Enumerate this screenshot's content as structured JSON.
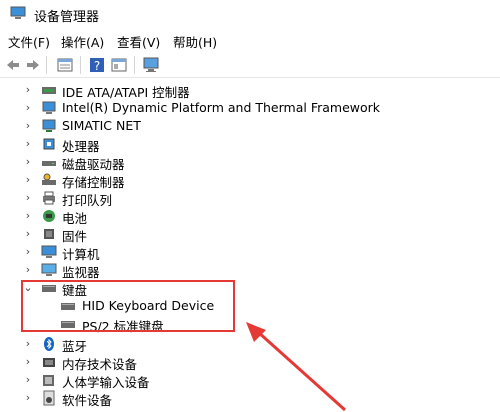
{
  "window": {
    "title": "设备管理器"
  },
  "menu": [
    {
      "label": "文件(F)"
    },
    {
      "label": "操作(A)"
    },
    {
      "label": "查看(V)"
    },
    {
      "label": "帮助(H)"
    }
  ],
  "toolbar": {
    "buttons": [
      "back-icon",
      "forward-icon",
      "properties-icon",
      "help-icon",
      "details-icon",
      "computer-icon"
    ]
  },
  "tree": [
    {
      "label": "IDE ATA/ATAPI 控制器",
      "icon": "ide-controller-icon",
      "expanded": false
    },
    {
      "label": "Intel(R) Dynamic Platform and Thermal Framework",
      "icon": "thermal-icon",
      "expanded": false
    },
    {
      "label": "SIMATIC NET",
      "icon": "network-icon",
      "expanded": false
    },
    {
      "label": "处理器",
      "icon": "processor-icon",
      "expanded": false
    },
    {
      "label": "磁盘驱动器",
      "icon": "disk-drive-icon",
      "expanded": false
    },
    {
      "label": "存储控制器",
      "icon": "storage-controller-icon",
      "expanded": false
    },
    {
      "label": "打印队列",
      "icon": "printer-icon",
      "expanded": false
    },
    {
      "label": "电池",
      "icon": "battery-icon",
      "expanded": false
    },
    {
      "label": "固件",
      "icon": "firmware-icon",
      "expanded": false
    },
    {
      "label": "计算机",
      "icon": "computer-icon",
      "expanded": false
    },
    {
      "label": "监视器",
      "icon": "monitor-icon",
      "expanded": false
    },
    {
      "label": "键盘",
      "icon": "keyboard-icon",
      "expanded": true
    },
    {
      "label": "HID Keyboard Device",
      "icon": "keyboard-icon",
      "child": true
    },
    {
      "label": "PS/2 标准键盘",
      "icon": "keyboard-icon",
      "child": true
    },
    {
      "label": "蓝牙",
      "icon": "bluetooth-icon",
      "expanded": false
    },
    {
      "label": "内存技术设备",
      "icon": "memory-icon",
      "expanded": false
    },
    {
      "label": "人体学输入设备",
      "icon": "hid-icon",
      "expanded": false
    },
    {
      "label": "软件设备",
      "icon": "software-device-icon",
      "expanded": false
    }
  ],
  "colors": {
    "highlight": "#e53935",
    "accent": "#1976d2"
  }
}
